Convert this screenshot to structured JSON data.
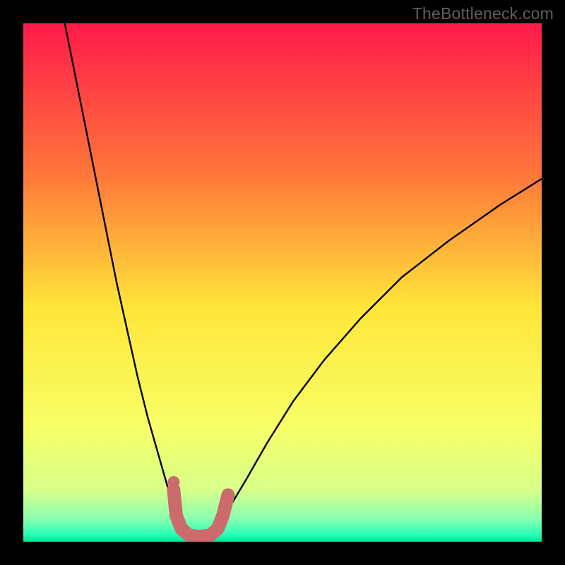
{
  "watermark": "TheBottleneck.com",
  "chart_data": {
    "type": "line",
    "title": "",
    "xlabel": "",
    "ylabel": "",
    "xlim": [
      0,
      100
    ],
    "ylim": [
      0,
      100
    ],
    "gradient_stops": [
      {
        "offset": 0.0,
        "color": "#ff1a4b"
      },
      {
        "offset": 0.3,
        "color": "#ff7a3a"
      },
      {
        "offset": 0.55,
        "color": "#ffe63a"
      },
      {
        "offset": 0.78,
        "color": "#f7ff66"
      },
      {
        "offset": 0.9,
        "color": "#d8ff8a"
      },
      {
        "offset": 0.955,
        "color": "#8cffb0"
      },
      {
        "offset": 0.985,
        "color": "#2dffb8"
      },
      {
        "offset": 1.0,
        "color": "#00e69a"
      }
    ],
    "series": [
      {
        "name": "bottleneck-curve-left",
        "x": [
          8,
          10,
          12,
          14,
          16,
          18,
          20,
          22,
          24,
          26,
          28,
          29.5,
          31,
          33
        ],
        "values": [
          100,
          90,
          80,
          70,
          60,
          50,
          41,
          32,
          24,
          17,
          10,
          5,
          2,
          0
        ]
      },
      {
        "name": "bottleneck-curve-right",
        "x": [
          36,
          38,
          40,
          43,
          47,
          52,
          58,
          65,
          73,
          82,
          92,
          100
        ],
        "values": [
          0,
          3,
          7,
          12,
          19,
          27,
          35,
          43,
          51,
          58,
          65,
          70
        ]
      },
      {
        "name": "marker-band",
        "x": [
          29.0,
          29.5,
          30.5,
          32.0,
          34.0,
          36.0,
          37.5,
          38.5,
          39.5
        ],
        "values": [
          10.0,
          5.0,
          2.5,
          1.2,
          1.0,
          1.2,
          2.5,
          5.0,
          9.0
        ]
      },
      {
        "name": "marker-dot",
        "x": [
          29.0
        ],
        "values": [
          11.5
        ]
      }
    ]
  }
}
